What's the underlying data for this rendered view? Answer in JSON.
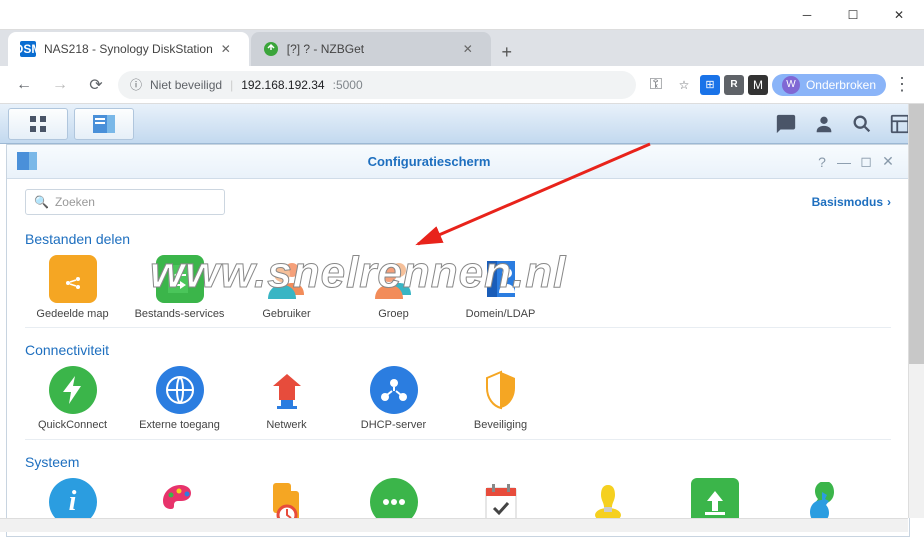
{
  "browser": {
    "tabs": [
      {
        "title": "NAS218 - Synology DiskStation",
        "active": true
      },
      {
        "title": "[?] ? - NZBGet",
        "active": false
      }
    ],
    "security_label": "Niet beveiligd",
    "url_host": "192.168.192.34",
    "url_port": ":5000",
    "profile_label": "Onderbroken",
    "profile_initial": "W"
  },
  "dsm": {
    "window_title": "Configuratiescherm",
    "search_placeholder": "Zoeken",
    "mode_label": "Basismodus",
    "sections": {
      "s1": {
        "title": "Bestanden delen"
      },
      "s2": {
        "title": "Connectiviteit"
      },
      "s3": {
        "title": "Systeem"
      }
    },
    "items": {
      "shared_folder": "Gedeelde map",
      "file_services": "Bestands-services",
      "user": "Gebruiker",
      "group": "Groep",
      "domain_ldap": "Domein/LDAP",
      "quickconnect": "QuickConnect",
      "external_access": "Externe toegang",
      "network": "Netwerk",
      "dhcp": "DHCP-server",
      "security": "Beveiliging"
    }
  },
  "watermark": "www.snelrennen.nl"
}
